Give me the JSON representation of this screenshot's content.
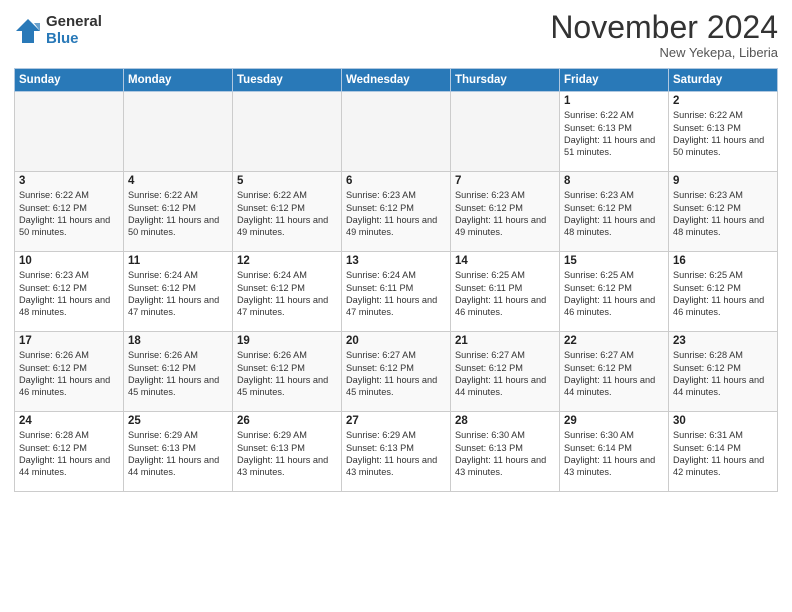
{
  "header": {
    "logo_general": "General",
    "logo_blue": "Blue",
    "month_title": "November 2024",
    "location": "New Yekepa, Liberia"
  },
  "weekdays": [
    "Sunday",
    "Monday",
    "Tuesday",
    "Wednesday",
    "Thursday",
    "Friday",
    "Saturday"
  ],
  "weeks": [
    [
      {
        "day": "",
        "text": ""
      },
      {
        "day": "",
        "text": ""
      },
      {
        "day": "",
        "text": ""
      },
      {
        "day": "",
        "text": ""
      },
      {
        "day": "",
        "text": ""
      },
      {
        "day": "1",
        "text": "Sunrise: 6:22 AM\nSunset: 6:13 PM\nDaylight: 11 hours\nand 51 minutes."
      },
      {
        "day": "2",
        "text": "Sunrise: 6:22 AM\nSunset: 6:13 PM\nDaylight: 11 hours\nand 50 minutes."
      }
    ],
    [
      {
        "day": "3",
        "text": "Sunrise: 6:22 AM\nSunset: 6:12 PM\nDaylight: 11 hours\nand 50 minutes."
      },
      {
        "day": "4",
        "text": "Sunrise: 6:22 AM\nSunset: 6:12 PM\nDaylight: 11 hours\nand 50 minutes."
      },
      {
        "day": "5",
        "text": "Sunrise: 6:22 AM\nSunset: 6:12 PM\nDaylight: 11 hours\nand 49 minutes."
      },
      {
        "day": "6",
        "text": "Sunrise: 6:23 AM\nSunset: 6:12 PM\nDaylight: 11 hours\nand 49 minutes."
      },
      {
        "day": "7",
        "text": "Sunrise: 6:23 AM\nSunset: 6:12 PM\nDaylight: 11 hours\nand 49 minutes."
      },
      {
        "day": "8",
        "text": "Sunrise: 6:23 AM\nSunset: 6:12 PM\nDaylight: 11 hours\nand 48 minutes."
      },
      {
        "day": "9",
        "text": "Sunrise: 6:23 AM\nSunset: 6:12 PM\nDaylight: 11 hours\nand 48 minutes."
      }
    ],
    [
      {
        "day": "10",
        "text": "Sunrise: 6:23 AM\nSunset: 6:12 PM\nDaylight: 11 hours\nand 48 minutes."
      },
      {
        "day": "11",
        "text": "Sunrise: 6:24 AM\nSunset: 6:12 PM\nDaylight: 11 hours\nand 47 minutes."
      },
      {
        "day": "12",
        "text": "Sunrise: 6:24 AM\nSunset: 6:12 PM\nDaylight: 11 hours\nand 47 minutes."
      },
      {
        "day": "13",
        "text": "Sunrise: 6:24 AM\nSunset: 6:11 PM\nDaylight: 11 hours\nand 47 minutes."
      },
      {
        "day": "14",
        "text": "Sunrise: 6:25 AM\nSunset: 6:11 PM\nDaylight: 11 hours\nand 46 minutes."
      },
      {
        "day": "15",
        "text": "Sunrise: 6:25 AM\nSunset: 6:12 PM\nDaylight: 11 hours\nand 46 minutes."
      },
      {
        "day": "16",
        "text": "Sunrise: 6:25 AM\nSunset: 6:12 PM\nDaylight: 11 hours\nand 46 minutes."
      }
    ],
    [
      {
        "day": "17",
        "text": "Sunrise: 6:26 AM\nSunset: 6:12 PM\nDaylight: 11 hours\nand 46 minutes."
      },
      {
        "day": "18",
        "text": "Sunrise: 6:26 AM\nSunset: 6:12 PM\nDaylight: 11 hours\nand 45 minutes."
      },
      {
        "day": "19",
        "text": "Sunrise: 6:26 AM\nSunset: 6:12 PM\nDaylight: 11 hours\nand 45 minutes."
      },
      {
        "day": "20",
        "text": "Sunrise: 6:27 AM\nSunset: 6:12 PM\nDaylight: 11 hours\nand 45 minutes."
      },
      {
        "day": "21",
        "text": "Sunrise: 6:27 AM\nSunset: 6:12 PM\nDaylight: 11 hours\nand 44 minutes."
      },
      {
        "day": "22",
        "text": "Sunrise: 6:27 AM\nSunset: 6:12 PM\nDaylight: 11 hours\nand 44 minutes."
      },
      {
        "day": "23",
        "text": "Sunrise: 6:28 AM\nSunset: 6:12 PM\nDaylight: 11 hours\nand 44 minutes."
      }
    ],
    [
      {
        "day": "24",
        "text": "Sunrise: 6:28 AM\nSunset: 6:12 PM\nDaylight: 11 hours\nand 44 minutes."
      },
      {
        "day": "25",
        "text": "Sunrise: 6:29 AM\nSunset: 6:13 PM\nDaylight: 11 hours\nand 44 minutes."
      },
      {
        "day": "26",
        "text": "Sunrise: 6:29 AM\nSunset: 6:13 PM\nDaylight: 11 hours\nand 43 minutes."
      },
      {
        "day": "27",
        "text": "Sunrise: 6:29 AM\nSunset: 6:13 PM\nDaylight: 11 hours\nand 43 minutes."
      },
      {
        "day": "28",
        "text": "Sunrise: 6:30 AM\nSunset: 6:13 PM\nDaylight: 11 hours\nand 43 minutes."
      },
      {
        "day": "29",
        "text": "Sunrise: 6:30 AM\nSunset: 6:14 PM\nDaylight: 11 hours\nand 43 minutes."
      },
      {
        "day": "30",
        "text": "Sunrise: 6:31 AM\nSunset: 6:14 PM\nDaylight: 11 hours\nand 42 minutes."
      }
    ]
  ]
}
